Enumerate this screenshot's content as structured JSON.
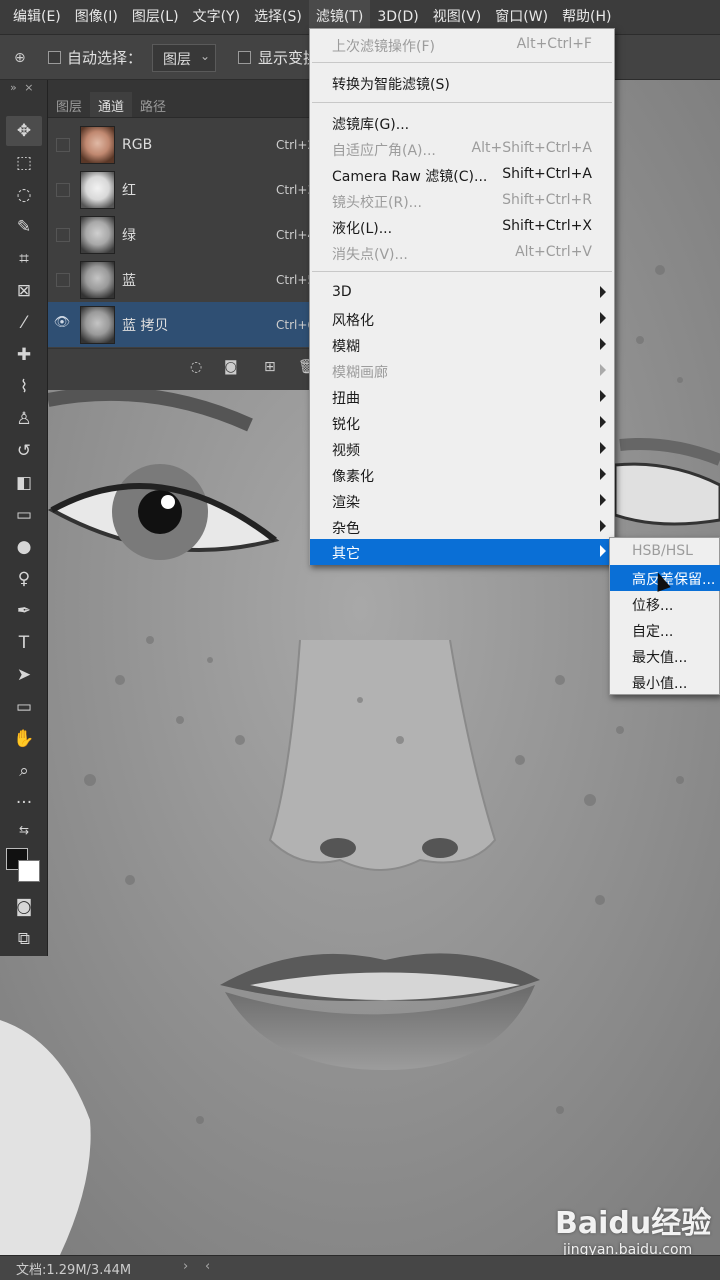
{
  "menubar": {
    "items": [
      "编辑(E)",
      "图像(I)",
      "图层(L)",
      "文字(Y)",
      "选择(S)",
      "滤镜(T)",
      "3D(D)",
      "视图(V)",
      "窗口(W)",
      "帮助(H)"
    ],
    "active_index": 5
  },
  "options_bar": {
    "auto_select_label": "自动选择：",
    "auto_select_value": "图层",
    "show_transform_label": "显示变换"
  },
  "channels_panel": {
    "tabs": [
      "图层",
      "通道",
      "路径"
    ],
    "active_tab": "通道",
    "channels": [
      {
        "name": "RGB",
        "shortcut": "Ctrl+2",
        "visible": false
      },
      {
        "name": "红",
        "shortcut": "Ctrl+3",
        "visible": false
      },
      {
        "name": "绿",
        "shortcut": "Ctrl+4",
        "visible": false
      },
      {
        "name": "蓝",
        "shortcut": "Ctrl+5",
        "visible": false
      },
      {
        "name": "蓝 拷贝",
        "shortcut": "Ctrl+6",
        "visible": true
      }
    ]
  },
  "filter_menu": {
    "items": [
      {
        "label": "上次滤镜操作(F)",
        "shortcut": "Alt+Ctrl+F",
        "disabled": true
      },
      {
        "label": "转换为智能滤镜(S)",
        "shortcut": "",
        "disabled": false
      },
      {
        "label": "滤镜库(G)...",
        "shortcut": "",
        "disabled": false
      },
      {
        "label": "自适应广角(A)...",
        "shortcut": "Alt+Shift+Ctrl+A",
        "disabled": true
      },
      {
        "label": "Camera Raw 滤镜(C)...",
        "shortcut": "Shift+Ctrl+A",
        "disabled": false
      },
      {
        "label": "镜头校正(R)...",
        "shortcut": "Shift+Ctrl+R",
        "disabled": true
      },
      {
        "label": "液化(L)...",
        "shortcut": "Shift+Ctrl+X",
        "disabled": false
      },
      {
        "label": "消失点(V)...",
        "shortcut": "Alt+Ctrl+V",
        "disabled": true
      },
      {
        "label": "3D",
        "submenu": true,
        "disabled": false
      },
      {
        "label": "风格化",
        "submenu": true,
        "disabled": false
      },
      {
        "label": "模糊",
        "submenu": true,
        "disabled": false
      },
      {
        "label": "模糊画廊",
        "submenu": true,
        "disabled": true
      },
      {
        "label": "扭曲",
        "submenu": true,
        "disabled": false
      },
      {
        "label": "锐化",
        "submenu": true,
        "disabled": false
      },
      {
        "label": "视频",
        "submenu": true,
        "disabled": false
      },
      {
        "label": "像素化",
        "submenu": true,
        "disabled": false
      },
      {
        "label": "渲染",
        "submenu": true,
        "disabled": false
      },
      {
        "label": "杂色",
        "submenu": true,
        "disabled": false
      },
      {
        "label": "其它",
        "submenu": true,
        "disabled": false,
        "highlighted": true
      }
    ]
  },
  "other_submenu": {
    "items": [
      {
        "label": "HSB/HSL",
        "disabled": true
      },
      {
        "label": "高反差保留...",
        "highlighted": true
      },
      {
        "label": "位移..."
      },
      {
        "label": "自定..."
      },
      {
        "label": "最大值..."
      },
      {
        "label": "最小值..."
      }
    ]
  },
  "status_bar": {
    "doc_info": "文档:1.29M/3.44M"
  },
  "watermark": {
    "logo": "Baidu经验",
    "url": "jingyan.baidu.com"
  },
  "colors": {
    "menu_highlight": "#0a6fd6",
    "active_channel_row": "#2f4f73",
    "menu_bg": "#efefef"
  }
}
